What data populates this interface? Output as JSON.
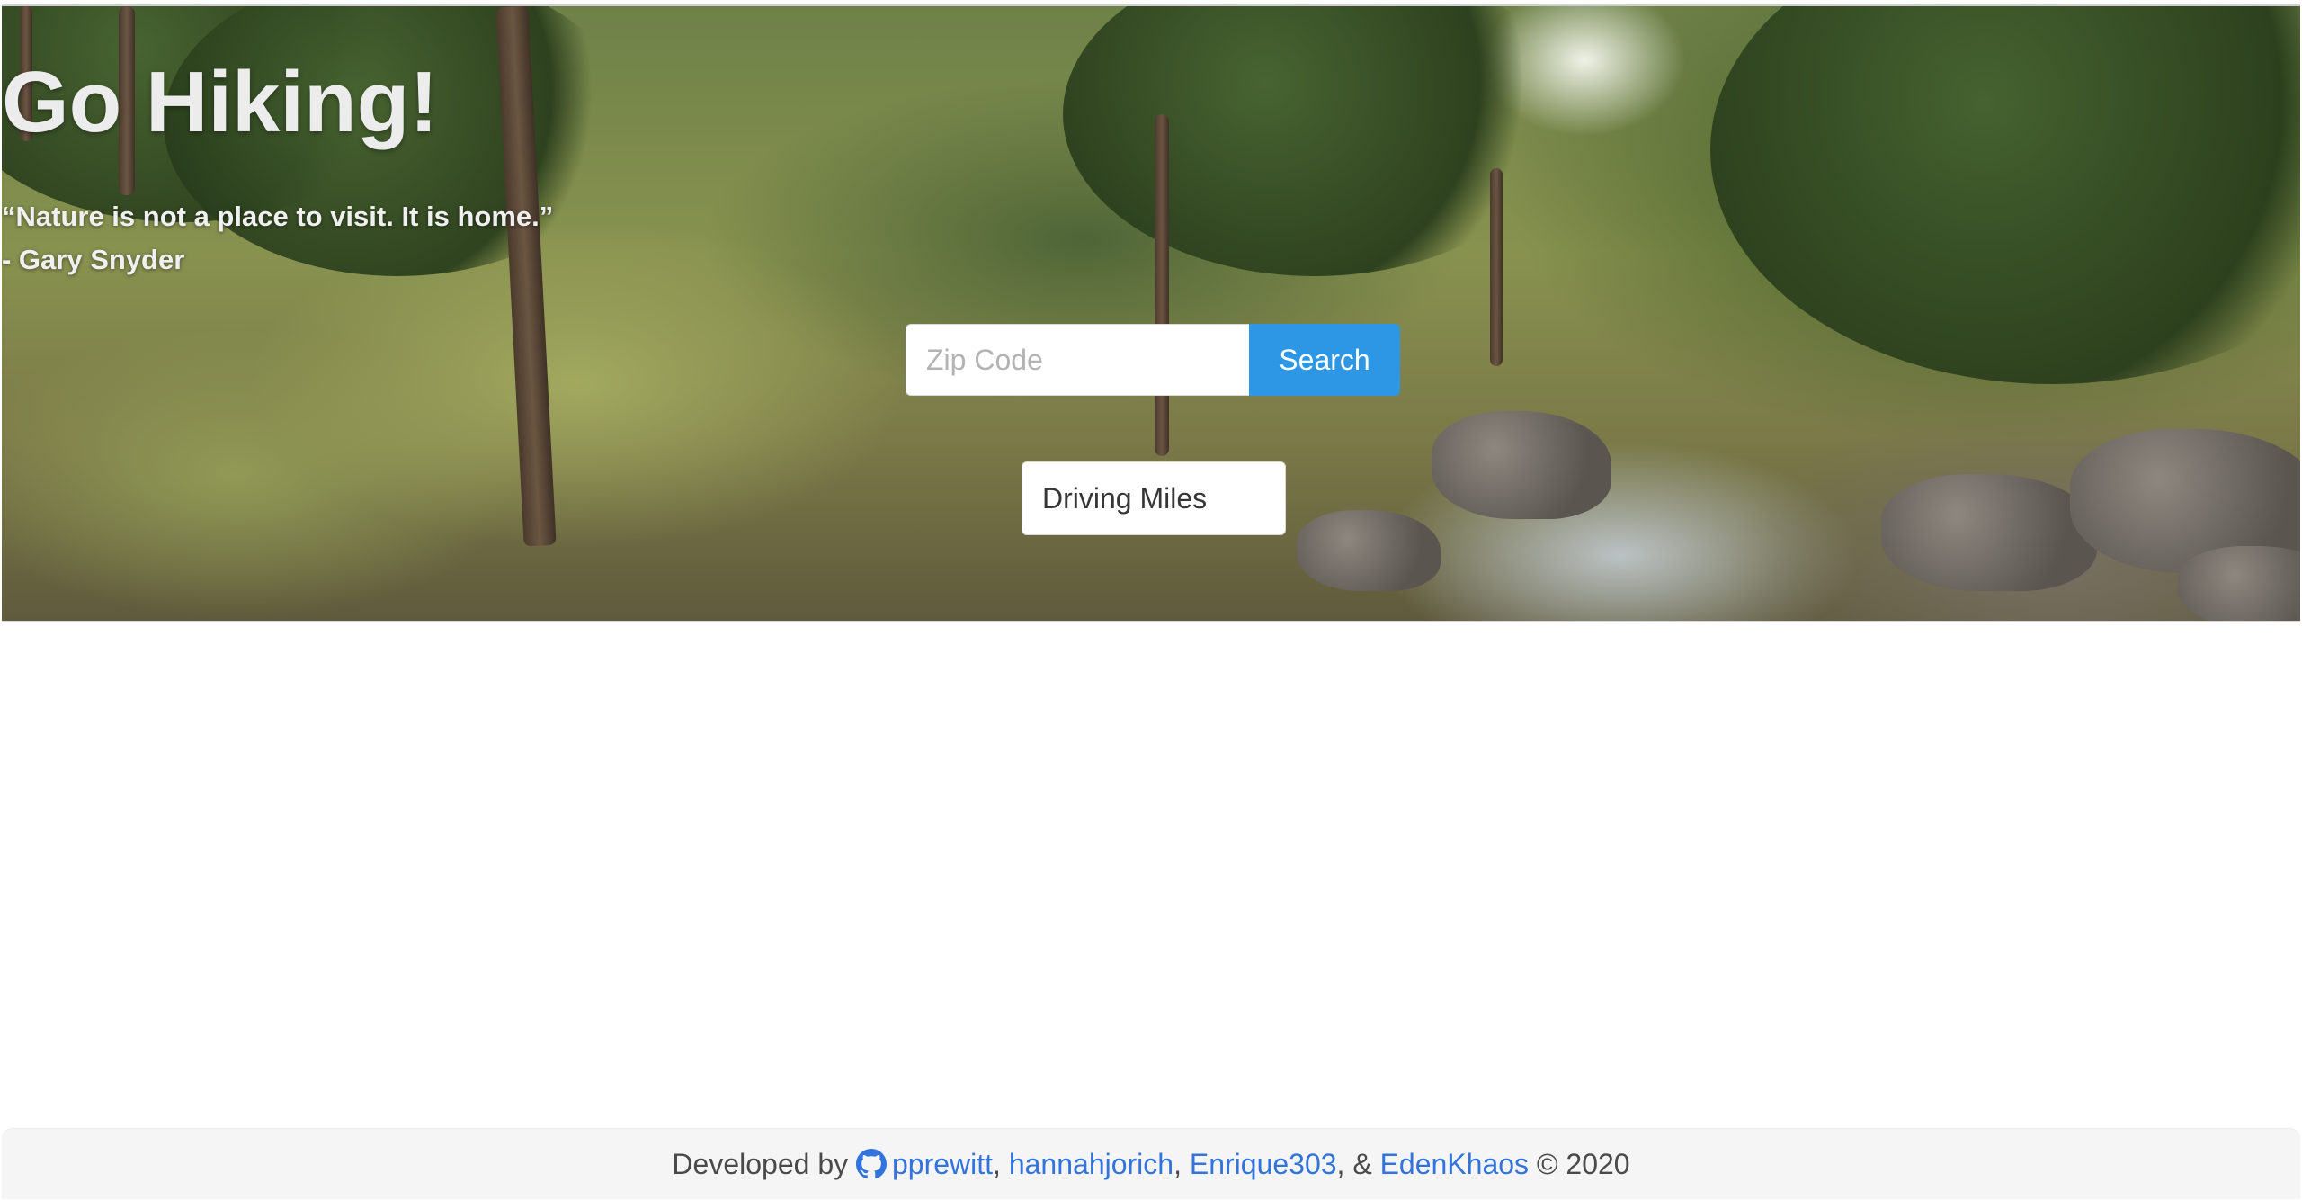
{
  "hero": {
    "title": "Go Hiking!",
    "quote_line": "“Nature is not a place to visit. It is home.”",
    "quote_author": "- Gary Snyder",
    "background_icon": "forest-stream-photo"
  },
  "search": {
    "placeholder": "Zip Code",
    "value": "",
    "button_label": "Search",
    "button_color": "#2d97e6"
  },
  "distance_select": {
    "selected": "Driving Miles"
  },
  "footer": {
    "prefix": "Developed by ",
    "icon": "github-icon",
    "authors": [
      "pprewitt",
      "hannahjorich",
      "Enrique303",
      "EdenKhaos"
    ],
    "sep1": ", ",
    "sep2": ", ",
    "sep3": ", & ",
    "suffix": " © 2020",
    "link_color": "#3273dc"
  }
}
